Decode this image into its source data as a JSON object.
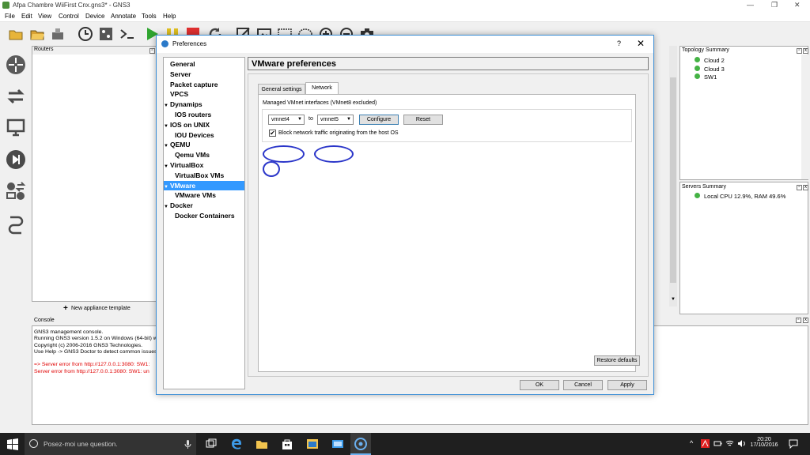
{
  "window": {
    "title": "Afpa Chambre WiiFirst Cnx.gns3* - GNS3"
  },
  "menu": [
    "File",
    "Edit",
    "View",
    "Control",
    "Device",
    "Annotate",
    "Tools",
    "Help"
  ],
  "panels": {
    "routers": "Routers",
    "new_template": "New appliance template",
    "console": "Console",
    "topology": "Topology Summary",
    "servers": "Servers Summary"
  },
  "topology_items": [
    "Cloud 2",
    "Cloud 3",
    "SW1"
  ],
  "servers_items": [
    "Local CPU 12.9%, RAM 49.6%"
  ],
  "console_lines": [
    {
      "text": "GNS3 management console.",
      "color": "#000000"
    },
    {
      "text": "Running GNS3 version 1.5.2 on Windows (64-bit) w",
      "color": "#000000"
    },
    {
      "text": "Copyright (c) 2006-2016 GNS3 Technologies.",
      "color": "#000000"
    },
    {
      "text": "Use Help -> GNS3 Doctor to detect common issues",
      "color": "#000000"
    },
    {
      "text": "",
      "color": "#000000"
    },
    {
      "text": "=> Server error from http://127.0.0.1:3080: SW1:",
      "color": "#e00000"
    },
    {
      "text": "Server error from http://127.0.0.1:3080: SW1: un",
      "color": "#e00000"
    }
  ],
  "dialog": {
    "title": "Preferences",
    "help": "?",
    "close": "✕",
    "heading": "VMware preferences",
    "nav": [
      {
        "label": "General",
        "indent": 0,
        "arrow": ""
      },
      {
        "label": "Server",
        "indent": 0,
        "arrow": ""
      },
      {
        "label": "Packet capture",
        "indent": 0,
        "arrow": ""
      },
      {
        "label": "VPCS",
        "indent": 0,
        "arrow": ""
      },
      {
        "label": "Dynamips",
        "indent": 0,
        "arrow": "▼"
      },
      {
        "label": "IOS routers",
        "indent": 1,
        "arrow": ""
      },
      {
        "label": "IOS on UNIX",
        "indent": 0,
        "arrow": "▼"
      },
      {
        "label": "IOU Devices",
        "indent": 1,
        "arrow": ""
      },
      {
        "label": "QEMU",
        "indent": 0,
        "arrow": "▼"
      },
      {
        "label": "Qemu VMs",
        "indent": 1,
        "arrow": ""
      },
      {
        "label": "VirtualBox",
        "indent": 0,
        "arrow": "▼"
      },
      {
        "label": "VirtualBox VMs",
        "indent": 1,
        "arrow": ""
      },
      {
        "label": "VMware",
        "indent": 0,
        "arrow": "▼",
        "selected": true
      },
      {
        "label": "VMware VMs",
        "indent": 1,
        "arrow": ""
      },
      {
        "label": "Docker",
        "indent": 0,
        "arrow": "▼"
      },
      {
        "label": "Docker Containers",
        "indent": 1,
        "arrow": ""
      }
    ],
    "tabs": [
      "General settings",
      "Network"
    ],
    "active_tab": "Network",
    "managed_label": "Managed VMnet interfaces (VMnet8 excluded)",
    "from_vmnet": "vmnet4",
    "to_label": "to",
    "to_vmnet": "vmnet5",
    "configure": "Configure",
    "reset": "Reset",
    "block_label": "Block network traffic originating from the host OS",
    "block_checked": "✔",
    "restore_defaults": "Restore defaults",
    "ok": "OK",
    "cancel": "Cancel",
    "apply": "Apply"
  },
  "taskbar": {
    "search_placeholder": "Posez-moi une question.",
    "time": "20:20",
    "date": "17/10/2016"
  },
  "colors": {
    "accent": "#3399ff",
    "annotation": "#2b36c9",
    "error": "#e00000"
  }
}
